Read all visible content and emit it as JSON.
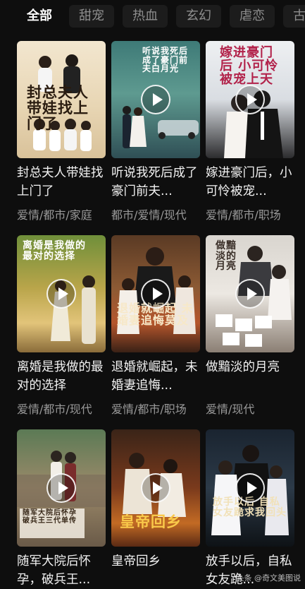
{
  "tabs": [
    "全部",
    "甜宠",
    "热血",
    "玄幻",
    "虐恋",
    "古"
  ],
  "cards": [
    {
      "title": "封总夫人带娃找上门了",
      "tags": "爱情/都市/家庭",
      "poster_text": "封总夫人带娃找上门了"
    },
    {
      "title": "听说我死后成了豪门前夫...",
      "tags": "都市/爱情/现代",
      "poster_text": "听说我死后成了豪门前夫白月光"
    },
    {
      "title": "嫁进豪门后，小可怜被宠...",
      "tags": "爱情/都市/职场",
      "poster_text": "嫁进豪门后 小可怜被宠上天"
    },
    {
      "title": "离婚是我做的最对的选择",
      "tags": "爱情/都市/现代",
      "poster_text": "离婚是我做的最对的选择"
    },
    {
      "title": "退婚就崛起，未婚妻追悔...",
      "tags": "爱情/都市/职场",
      "poster_text": "退婚就崛起 未婚妻追悔莫及"
    },
    {
      "title": "做黯淡的月亮",
      "tags": "爱情/现代",
      "poster_text": "做黯淡的月亮"
    },
    {
      "title": "随军大院后怀孕，破兵王...",
      "tags": "",
      "poster_text": "随军大院后怀孕 破兵王三代单传"
    },
    {
      "title": "皇帝回乡",
      "tags": "",
      "poster_text": "皇帝回乡"
    },
    {
      "title": "放手以后，自私女友跪...",
      "tags": "",
      "poster_text": "放手以后 自私女友跪求我回头"
    }
  ],
  "watermark": "头条 @奇文美图说"
}
